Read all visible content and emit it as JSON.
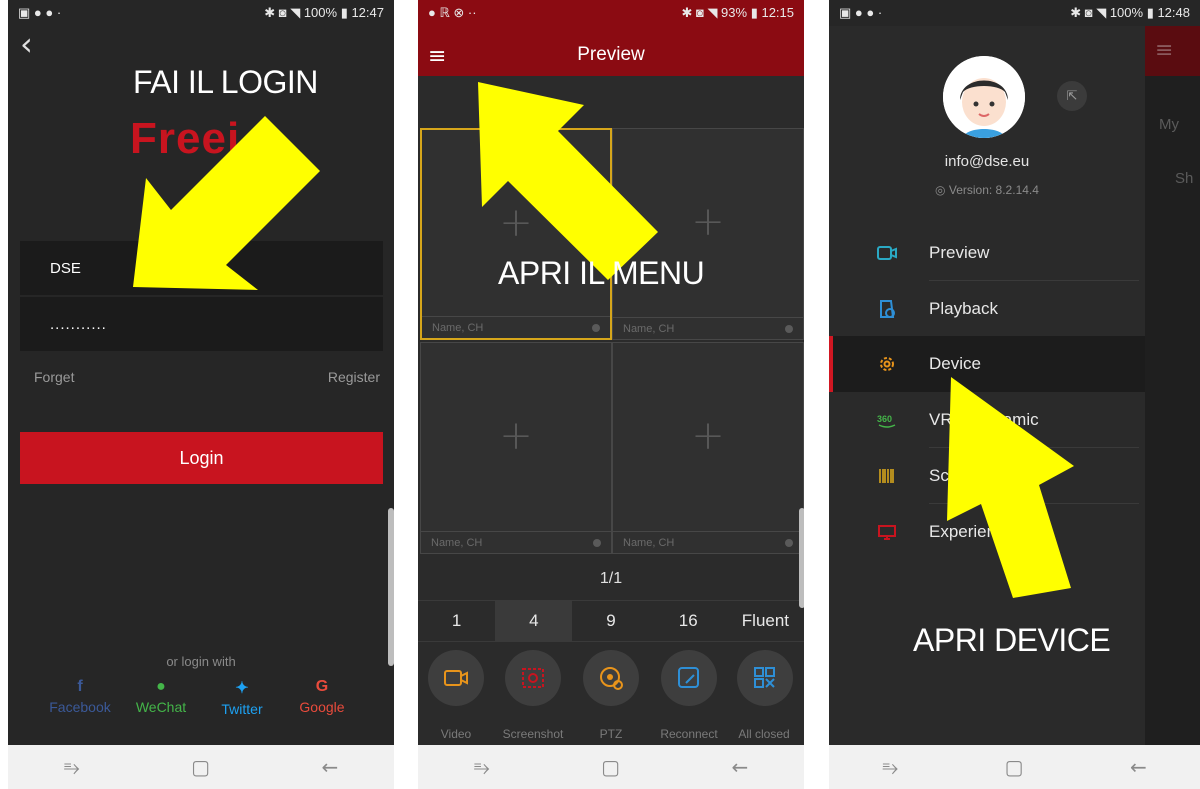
{
  "screens": [
    {
      "status": {
        "left": "▣ ● ● ·",
        "right": "✱ ◙ ◥ 100% ▮ 12:47"
      },
      "overlay": "FAI IL LOGIN",
      "brand": "Freei",
      "username": "DSE",
      "password": "...........",
      "forget": "Forget",
      "register": "Register",
      "login": "Login",
      "or_login_with": "or login with",
      "social": [
        {
          "label": "Facebook",
          "icon": "f",
          "color": "#3b5998"
        },
        {
          "label": "WeChat",
          "icon": "●",
          "color": "#44b549"
        },
        {
          "label": "Twitter",
          "icon": "✦",
          "color": "#1da1f2"
        },
        {
          "label": "Google",
          "icon": "G",
          "color": "#e94b3c"
        }
      ]
    },
    {
      "status": {
        "left": "● ℝ ⊗ ··",
        "right": "✱ ◙ ◥ 93% ▮ 12:15"
      },
      "title": "Preview",
      "overlay": "APRI IL MENU",
      "cells": [
        "Name, CH",
        "Name, CH",
        "Name, CH",
        "Name, CH"
      ],
      "pager": "1/1",
      "splits": [
        {
          "label": "1",
          "active": false
        },
        {
          "label": "4",
          "active": true
        },
        {
          "label": "9",
          "active": false
        },
        {
          "label": "16",
          "active": false
        },
        {
          "label": "Fluent",
          "active": false
        }
      ],
      "tools": [
        {
          "label": "Video",
          "icon": "video-icon",
          "color": "#e8941b"
        },
        {
          "label": "Screenshot",
          "icon": "screenshot-icon",
          "color": "#c8141f"
        },
        {
          "label": "PTZ",
          "icon": "ptz-icon",
          "color": "#e8941b"
        },
        {
          "label": "Reconnect",
          "icon": "reconnect-icon",
          "color": "#2e8fd6"
        },
        {
          "label": "All closed",
          "icon": "all-closed-icon",
          "color": "#2e8fd6"
        }
      ]
    },
    {
      "status": {
        "left": "▣ ● ● ·",
        "right": "✱ ◙ ◥ 100% ▮ 12:48"
      },
      "overlay": "APRI DEVICE",
      "email": "info@dse.eu",
      "version": "Version: 8.2.14.4",
      "bg_items": [
        "My",
        "Sh"
      ],
      "menu": [
        {
          "label": "Preview",
          "icon": "preview-icon",
          "color": "#2aa9c4",
          "active": false
        },
        {
          "label": "Playback",
          "icon": "playback-icon",
          "color": "#2e8fd6",
          "active": false
        },
        {
          "label": "Device",
          "icon": "device-icon",
          "color": "#e8941b",
          "active": true
        },
        {
          "label": "VR Panoramic",
          "icon": "vr-icon",
          "color": "#44b549",
          "active": false
        },
        {
          "label": "Scan",
          "icon": "scan-icon",
          "color": "#d6a61b",
          "active": false
        },
        {
          "label": "Experience",
          "icon": "experience-icon",
          "color": "#c8141f",
          "active": false
        }
      ]
    }
  ]
}
